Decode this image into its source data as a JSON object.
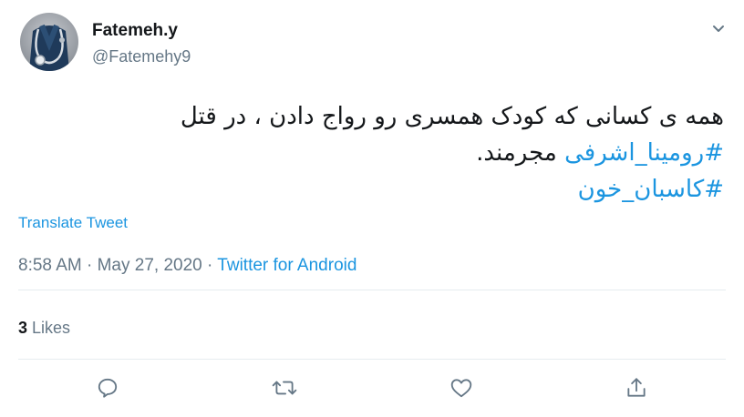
{
  "author": {
    "name": "Fatemeh.y",
    "handle": "@Fatemehy9",
    "avatar": "avatar-stethoscope-image"
  },
  "tweet": {
    "line1": "همه ی کسانی که کودک همسری رو رواج دادن ، در قتل",
    "hashtag1": "#رومینا_اشرفی",
    "line2_suffix": "مجرمند.",
    "hashtag2": "#کاسبان_خون"
  },
  "translate_label": "Translate Tweet",
  "meta": {
    "time": "8:58 AM",
    "separator1": " · ",
    "date": "May 27, 2020",
    "separator2": " · ",
    "source": "Twitter for Android"
  },
  "stats": {
    "likes_count": "3",
    "likes_label": "Likes"
  },
  "actions": {
    "reply": "reply-icon",
    "retweet": "retweet-icon",
    "like": "heart-icon",
    "share": "share-icon"
  },
  "colors": {
    "link": "#1b95e0",
    "secondary_text": "#657786",
    "primary_text": "#14171a",
    "divider": "#e6ecf0"
  }
}
